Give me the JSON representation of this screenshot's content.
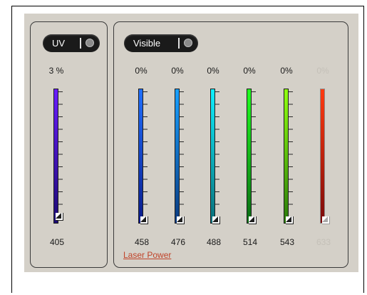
{
  "groups": {
    "uv": {
      "toggle_label": "UV"
    },
    "visible": {
      "toggle_label": "Visible"
    }
  },
  "channels": [
    {
      "wavelength": "405",
      "power": "3 %",
      "level": 0.03,
      "enabled": true,
      "color_top": "#6a1cff",
      "color_bottom": "#1b0a73",
      "icon": "slider-handle-icon"
    },
    {
      "wavelength": "458",
      "power": "0%",
      "level": 0.0,
      "enabled": true,
      "color_top": "#2070ff",
      "color_bottom": "#0a1a8a",
      "icon": "slider-handle-icon"
    },
    {
      "wavelength": "476",
      "power": "0%",
      "level": 0.0,
      "enabled": true,
      "color_top": "#18a0ff",
      "color_bottom": "#0a3a80",
      "icon": "slider-handle-icon"
    },
    {
      "wavelength": "488",
      "power": "0%",
      "level": 0.0,
      "enabled": true,
      "color_top": "#10f0ff",
      "color_bottom": "#0a6f7a",
      "icon": "slider-handle-icon"
    },
    {
      "wavelength": "514",
      "power": "0%",
      "level": 0.0,
      "enabled": true,
      "color_top": "#20ff20",
      "color_bottom": "#0a6a14",
      "icon": "slider-handle-icon"
    },
    {
      "wavelength": "543",
      "power": "0%",
      "level": 0.0,
      "enabled": true,
      "color_top": "#90ff10",
      "color_bottom": "#2a7a0a",
      "icon": "slider-handle-icon"
    },
    {
      "wavelength": "633",
      "power": "0%",
      "level": 0.0,
      "enabled": false,
      "color_top": "#ff3a10",
      "color_bottom": "#7a0a0a",
      "icon": "slider-handle-icon"
    }
  ],
  "caption": "Laser Power",
  "colors": {
    "panel": "#d4d0c8",
    "caption": "#c0442a",
    "disabled_text": "#c4c0b8"
  }
}
